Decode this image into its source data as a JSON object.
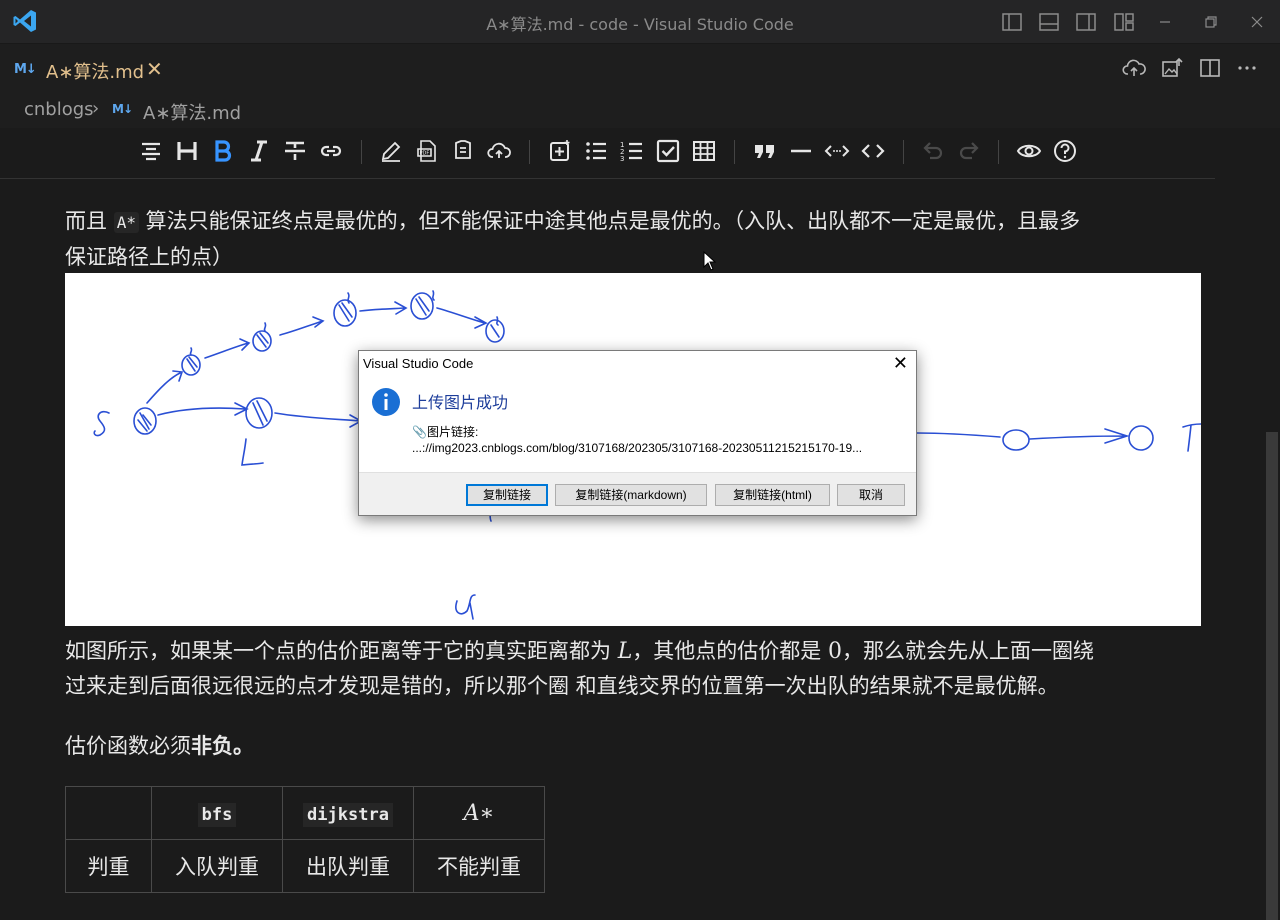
{
  "window": {
    "title": "A∗算法.md - code - Visual Studio Code"
  },
  "tab": {
    "md_badge": "M↓",
    "label": "A∗算法.md",
    "close": "✕"
  },
  "breadcrumb": {
    "folder": "cnblogs",
    "separator": "›",
    "md_badge": "M↓",
    "file": "A∗算法.md"
  },
  "toolbar": {
    "icons": [
      "align-icon",
      "heading-icon",
      "bold-icon",
      "italic-icon",
      "strikethrough-icon",
      "link-icon",
      "edit-icon",
      "pdf-export-icon",
      "copy-html-icon",
      "upload-icon",
      "insert-image-icon",
      "bullet-list-icon",
      "numbered-list-icon",
      "checkbox-icon",
      "table-icon",
      "quote-icon",
      "horizontal-rule-icon",
      "inline-code-icon",
      "code-block-icon",
      "undo-icon",
      "redo-icon",
      "preview-icon",
      "help-icon"
    ]
  },
  "content": {
    "p1_a": "而且 ",
    "p1_code": "A*",
    "p1_b": " 算法只能保证终点是最优的，但不能保证中途其他点是最优的。（入队、出队都不一定是最优，且最多",
    "p1_c": "保证路径上的点）",
    "p2_a": "如图所示，如果某一个点的估价距离等于它的真实距离都为 ",
    "p2_L": "L",
    "p2_b": "，其他点的估价都是 ",
    "p2_zero": "0",
    "p2_c": "，那么就会先从上面一圈绕",
    "p2_d": "过来走到后面很远很远的点才发现是错的，所以那个圈 和直线交界的位置第一次出队的结果就不是最优解。",
    "p3_a": "估价函数必须",
    "p3_bold": "非负。"
  },
  "drawing": {
    "labels": {
      "S": "S",
      "L": "L",
      "T": "T",
      "four": "4"
    }
  },
  "table": {
    "header": [
      "",
      "bfs",
      "dijkstra",
      "A∗"
    ],
    "row": [
      "判重",
      "入队判重",
      "出队判重",
      "不能判重"
    ]
  },
  "dialog": {
    "title": "Visual Studio Code",
    "close": "✕",
    "heading": "上传图片成功",
    "label": "图片链接:",
    "url": "...://img2023.cnblogs.com/blog/3107168/202305/3107168-20230511215215170-19...",
    "buttons": {
      "copy_link": "复制链接",
      "copy_markdown": "复制链接(markdown)",
      "copy_html": "复制链接(html)",
      "cancel": "取消"
    }
  },
  "colors": {
    "accent": "#3794ff",
    "tab_modified": "#e2c08d",
    "dialog_heading": "#1e3e9b",
    "ink": "#2a4fd4"
  }
}
